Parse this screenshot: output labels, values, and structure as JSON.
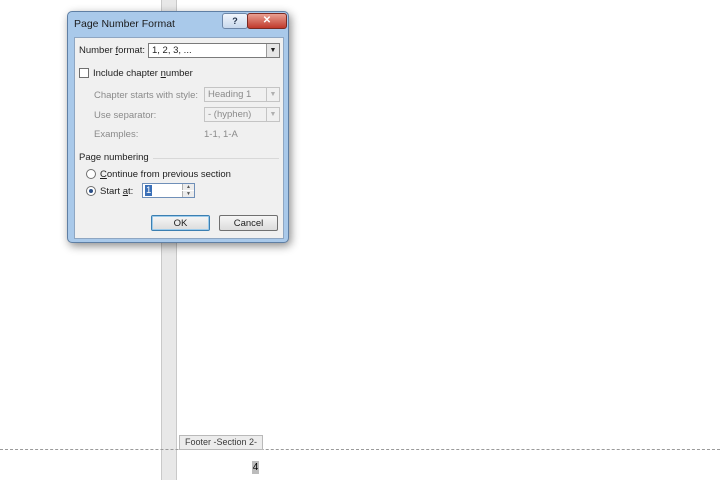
{
  "dialog": {
    "title": "Page Number Format",
    "help_label": "?",
    "close_label": "✕",
    "number_format": {
      "label_pre": "Number ",
      "label_u": "f",
      "label_post": "ormat:",
      "value": "1, 2, 3, ..."
    },
    "include_chapter": {
      "label_pre": "Include chapter ",
      "label_u": "n",
      "label_post": "umber",
      "checked": false
    },
    "chapter_style": {
      "label": "Chapter starts with style:",
      "value": "Heading 1"
    },
    "separator": {
      "label": "Use separator:",
      "value": "-   (hyphen)"
    },
    "examples": {
      "label": "Examples:",
      "value": "1-1, 1-A"
    },
    "page_numbering": {
      "heading": "Page numbering",
      "continue": {
        "label_pre": "",
        "label_u": "C",
        "label_post": "ontinue from previous section",
        "selected": false
      },
      "start_at": {
        "label_pre": "Start ",
        "label_u": "a",
        "label_post": "t:",
        "selected": true,
        "value": "1"
      }
    },
    "ok_label": "OK",
    "cancel_label": "Cancel"
  },
  "document": {
    "footer_tag": "Footer -Section 2-",
    "page_number": "4"
  }
}
